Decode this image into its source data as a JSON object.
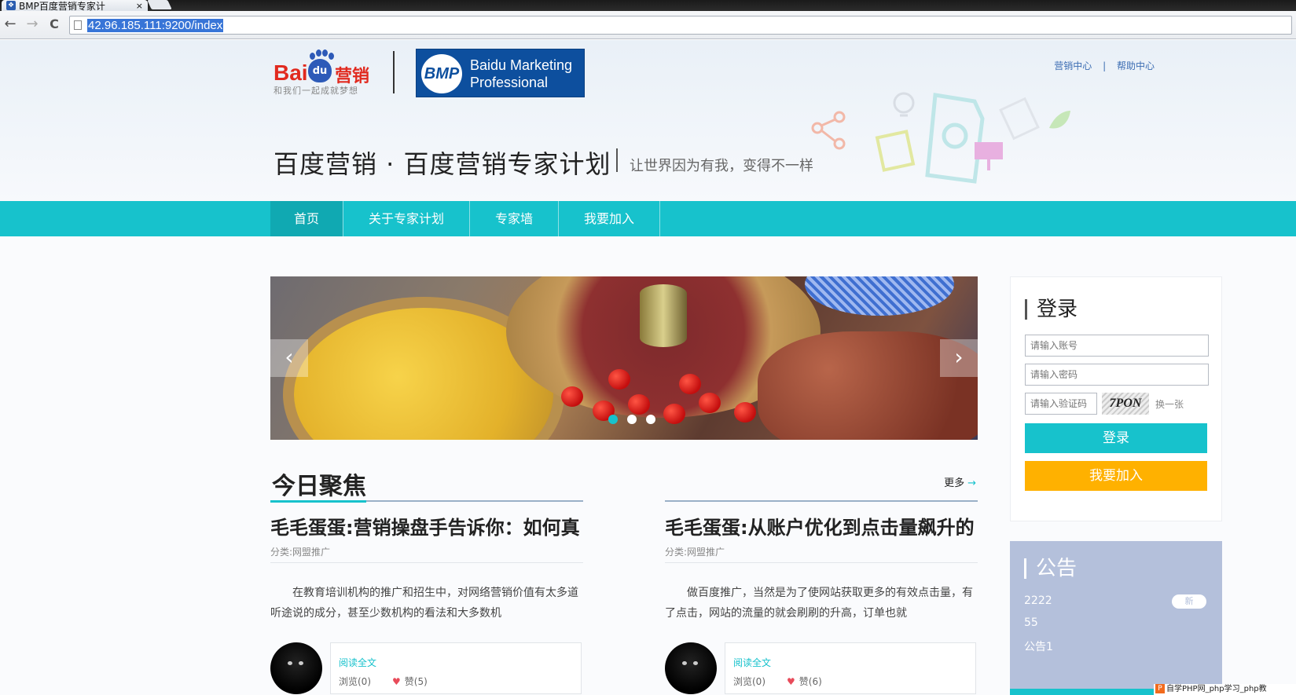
{
  "browser": {
    "tab_title": "BMP百度营销专家计",
    "tab_close": "×",
    "back": "←",
    "forward": "→",
    "reload": "C",
    "url": "42.96.185.111:9200/index"
  },
  "header": {
    "baidu_logo_bai": "Bai",
    "baidu_logo_du": "du",
    "baidu_logo_yx": "营销",
    "baidu_slogan": "和我们一起成就梦想",
    "bmp_badge": "BMP",
    "bmp_line1": "Baidu Marketing",
    "bmp_line2": "Professional",
    "top_links": [
      "营销中心",
      "帮助中心"
    ],
    "top_links_sep": "|",
    "site_title": "百度营销 · 百度营销专家计划",
    "site_slogan": "让世界因为有我，变得不一样"
  },
  "nav": {
    "items": [
      "首页",
      "关于专家计划",
      "专家墙",
      "我要加入"
    ],
    "active_index": 0
  },
  "slider": {
    "prev": "‹",
    "next": "›",
    "dot_count": 3,
    "active_dot": 0
  },
  "focus": {
    "title": "今日聚焦",
    "more": "更多",
    "more_arrow": "→",
    "articles": [
      {
        "title": "毛毛蛋蛋:营销操盘手告诉你：如何真",
        "category": "分类:网盟推广",
        "body": "在教育培训机构的推广和招生中，对网络营销价值有太多道听途说的成分，甚至少数机构的看法和大多数机",
        "read": "阅读全文",
        "views": "浏览(0)",
        "likes": "赞(5)"
      },
      {
        "title": "毛毛蛋蛋:从账户优化到点击量飙升的",
        "category": "分类:网盟推广",
        "body": "做百度推广，当然是为了使网站获取更多的有效点击量，有了点击，网站的流量的就会刷刷的升高，订单也就",
        "read": "阅读全文",
        "views": "浏览(0)",
        "likes": "赞(6)"
      }
    ]
  },
  "login": {
    "title": "登录",
    "user_placeholder": "请输入账号",
    "pass_placeholder": "请输入密码",
    "code_placeholder": "请输入验证码",
    "captcha": "7PON",
    "refresh": "换一张",
    "login_btn": "登录",
    "join_btn": "我要加入"
  },
  "notice": {
    "title": "公告",
    "items": [
      "2222",
      "55",
      "公告1"
    ],
    "new_badge": "新"
  },
  "watermark": {
    "logo": "P",
    "text": "自学PHP网_php学习_php教"
  },
  "colors": {
    "accent": "#17c2cc",
    "accent_dark": "#10a9b2",
    "join": "#ffb100",
    "notice_bg": "#b4c0db",
    "bmp_blue": "#0d4f9e",
    "baidu_red": "#e12a1f"
  }
}
